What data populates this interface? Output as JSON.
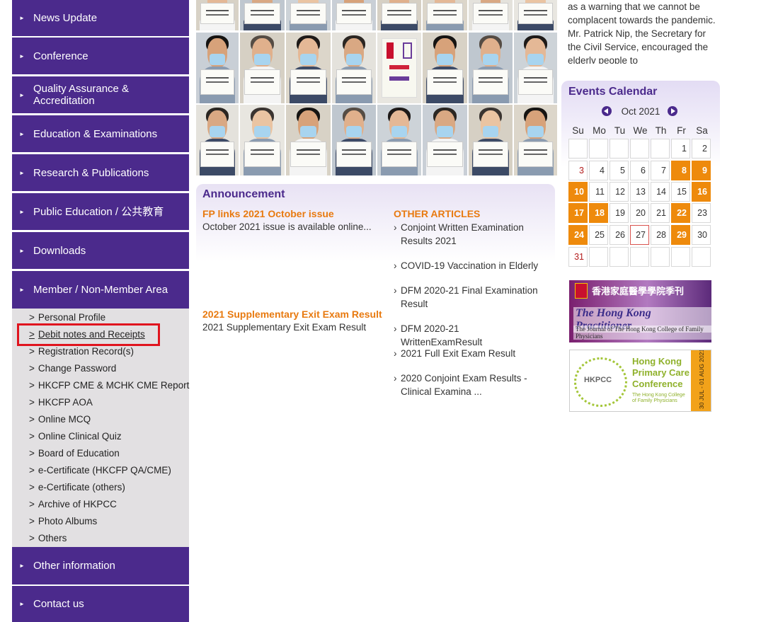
{
  "sidebar": {
    "items": [
      {
        "label": "News Update"
      },
      {
        "label": "Conference"
      },
      {
        "label": "Quality Assurance & Accreditation"
      },
      {
        "label": "Education & Examinations"
      },
      {
        "label": "Research & Publications"
      },
      {
        "label": "Public Education / 公共教育"
      },
      {
        "label": "Downloads"
      },
      {
        "label": "Member / Non-Member Area"
      },
      {
        "label": "Other information"
      },
      {
        "label": "Contact us"
      }
    ],
    "submenu": [
      {
        "label": "Personal Profile"
      },
      {
        "label": "Debit notes and Receipts"
      },
      {
        "label": "Registration Record(s)"
      },
      {
        "label": "Change Password"
      },
      {
        "label": "HKCFP CME & MCHK CME Report"
      },
      {
        "label": "HKCFP AOA"
      },
      {
        "label": "Online MCQ"
      },
      {
        "label": "Online Clinical Quiz"
      },
      {
        "label": "Board of Education"
      },
      {
        "label": "e-Certificate (HKCFP QA/CME)"
      },
      {
        "label": "e-Certificate (others)"
      },
      {
        "label": "Archive of HKPCC"
      },
      {
        "label": "Photo Albums"
      },
      {
        "label": "Others"
      }
    ],
    "submenu_prefix": ">"
  },
  "news_snippet": "as a warning that we cannot be complacent towards the pandemic. Mr. Patrick Nip, the Secretary for the Civil Service, encouraged the elderly people to",
  "announcement": {
    "title": "Announcement",
    "fp_title": "FP links 2021 October issue",
    "fp_text": "October 2021 issue is available online...",
    "supp_title": "2021 Supplementary Exit Exam Result",
    "supp_text": "2021 Supplementary Exit Exam Result",
    "other_title": "OTHER ARTICLES",
    "other_prefix": "›",
    "other_items": [
      {
        "label": "Conjoint Written Examination Results 2021"
      },
      {
        "label": "COVID-19 Vaccination in Elderly"
      },
      {
        "label": "DFM 2020-21 Final Examination Result"
      },
      {
        "label": "DFM 2020-21 WrittenExamResult"
      },
      {
        "label": "2021 Full Exit Exam Result"
      },
      {
        "label": "2020 Conjoint Exam Results - Clinical Examina ..."
      }
    ]
  },
  "calendar": {
    "title": "Events Calendar",
    "month": "Oct 2021",
    "days_of_week": [
      "Su",
      "Mo",
      "Tu",
      "We",
      "Th",
      "Fr",
      "Sa"
    ],
    "weeks": [
      [
        "",
        "",
        "",
        "",
        "",
        "1",
        "2"
      ],
      [
        "3",
        "4",
        "5",
        "6",
        "7",
        "8",
        "9"
      ],
      [
        "10",
        "11",
        "12",
        "13",
        "14",
        "15",
        "16"
      ],
      [
        "17",
        "18",
        "19",
        "20",
        "21",
        "22",
        "23"
      ],
      [
        "24",
        "25",
        "26",
        "27",
        "28",
        "29",
        "30"
      ],
      [
        "31",
        "",
        "",
        "",
        "",
        "",
        ""
      ]
    ],
    "event_days": [
      "8",
      "9",
      "10",
      "16",
      "17",
      "18",
      "22",
      "24",
      "29"
    ],
    "today": "27",
    "colors": {
      "event": "#ee8a0c",
      "accent": "#4b2a8c",
      "sunday": "#b31c1c"
    }
  },
  "banners": {
    "hkp_chinese": "香港家庭醫學學院季刊",
    "hkp_title": "The Hong Kong Practitioner",
    "hkp_subtitle": "The Journal of The Hong Kong College of Family Physicians",
    "hkpcc_logo": "HKPCC",
    "hkpcc_title_1": "Hong Kong",
    "hkpcc_title_2": "Primary Care",
    "hkpcc_title_3": "Conference",
    "hkpcc_org": "The Hong Kong College of Family Physicians",
    "hkpcc_dates": "30 JUL - 01 AUG 2021  FRI - SUN"
  },
  "photo_grid": {
    "poster_text": "I STAY AT WORK FOR YOU / YOU STAY AT HOME FOR US"
  },
  "theme": {
    "nav_bg": "#4b2a8c",
    "submenu_bg": "#e2e0e2",
    "highlight": "#e0141e",
    "orange": "#e87a10"
  }
}
